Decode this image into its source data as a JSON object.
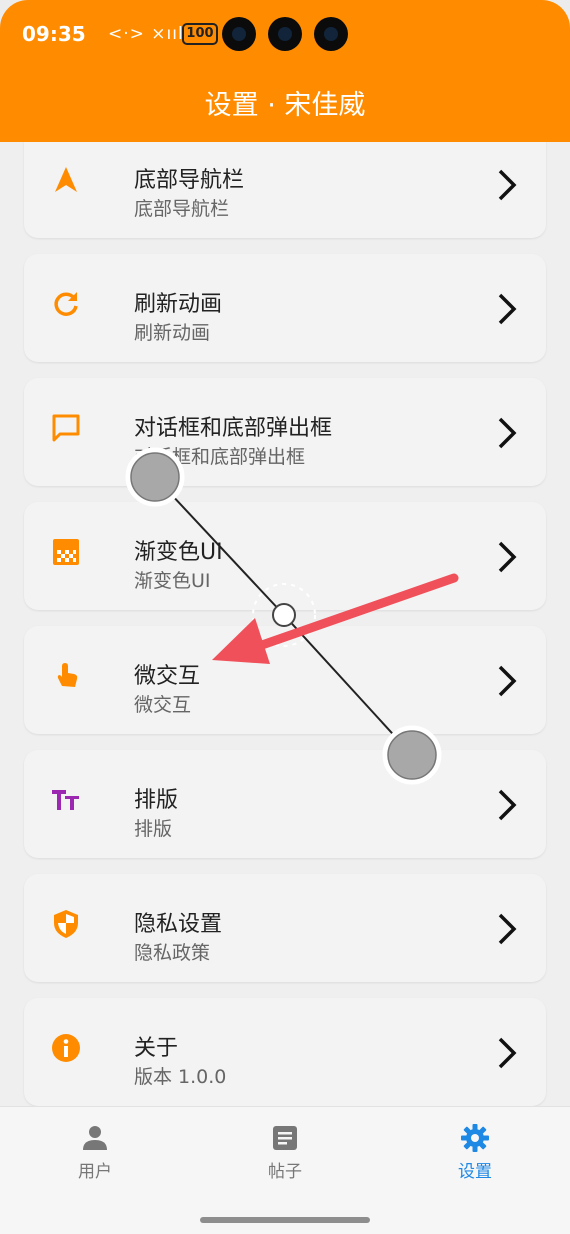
{
  "status": {
    "time": "09:35",
    "glyphs": "<·> ×ııl",
    "battery": "100"
  },
  "header": {
    "title": "设置 · 宋佳威"
  },
  "items": [
    {
      "label": "底部导航栏",
      "sub": "底部导航栏",
      "icon": "navigation-arrow-icon"
    },
    {
      "label": "刷新动画",
      "sub": "刷新动画",
      "icon": "refresh-icon"
    },
    {
      "label": "对话框和底部弹出框",
      "sub": "对话框和底部弹出框",
      "icon": "chat-bubble-icon"
    },
    {
      "label": "渐变色UI",
      "sub": "渐变色UI",
      "icon": "gradient-icon"
    },
    {
      "label": "微交互",
      "sub": "微交互",
      "icon": "touch-icon"
    },
    {
      "label": "排版",
      "sub": "排版",
      "icon": "text-format-icon"
    },
    {
      "label": "隐私设置",
      "sub": "隐私政策",
      "icon": "privacy-shield-icon"
    },
    {
      "label": "关于",
      "sub": "版本 1.0.0",
      "icon": "info-icon"
    }
  ],
  "bottom_nav": {
    "tabs": [
      {
        "label": "用户",
        "icon": "person-icon",
        "active": false
      },
      {
        "label": "帖子",
        "icon": "article-icon",
        "active": false
      },
      {
        "label": "设置",
        "icon": "settings-gear-icon",
        "active": true
      }
    ]
  },
  "colors": {
    "app_bar": "#ff8c00",
    "icon_orange": "#ff8c00",
    "icon_purple": "#9c27b0",
    "active_tab": "#1e88e5",
    "annotation_arrow": "#f0505a"
  }
}
